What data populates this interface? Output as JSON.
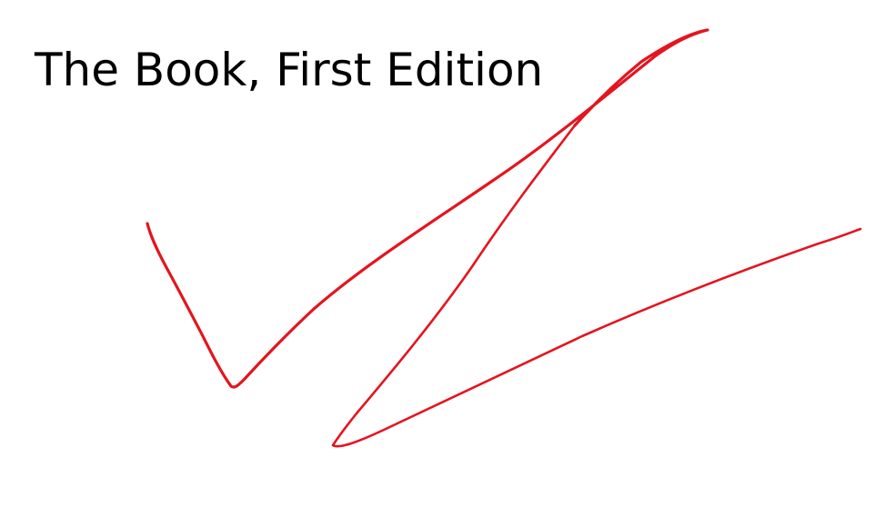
{
  "slide": {
    "title": "The Book, First Edition"
  },
  "ink": {
    "color": "#e3151f",
    "strokes": [
      "checkmark-stroke",
      "zigzag-stroke"
    ]
  }
}
